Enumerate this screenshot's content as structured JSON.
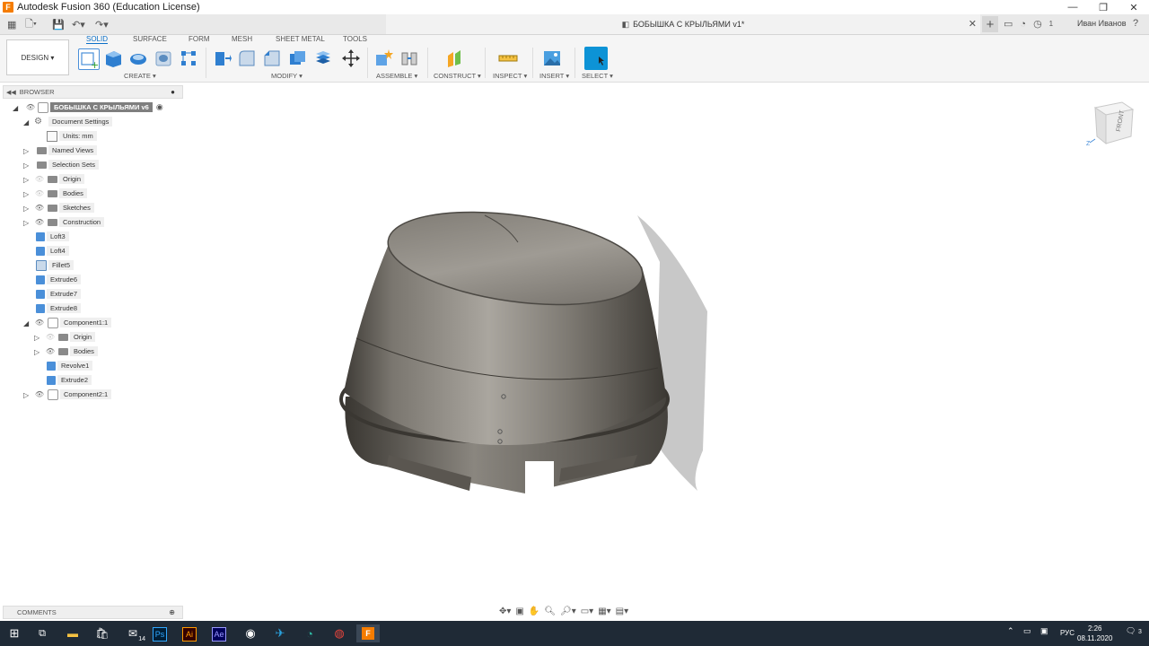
{
  "window": {
    "title": "Autodesk Fusion 360 (Education License)",
    "app_icon": "F"
  },
  "document_tab": {
    "title": "БОБЫШКА С КРЫЛЬЯМИ v1*"
  },
  "user": {
    "name": "Иван Иванов",
    "notifications": "1"
  },
  "ribbon": {
    "workspace": "DESIGN ▾",
    "tabs": [
      "SOLID",
      "SURFACE",
      "FORM",
      "MESH",
      "SHEET METAL",
      "TOOLS"
    ],
    "groups": {
      "create": "CREATE ▾",
      "modify": "MODIFY ▾",
      "assemble": "ASSEMBLE ▾",
      "construct": "CONSTRUCT ▾",
      "inspect": "INSPECT ▾",
      "insert": "INSERT ▾",
      "select": "SELECT ▾"
    }
  },
  "browser": {
    "title": "BROWSER",
    "items": [
      {
        "label": "БОБЫШКА С КРЫЛЬЯМИ v6"
      },
      {
        "label": "Document Settings"
      },
      {
        "label": "Units: mm"
      },
      {
        "label": "Named Views"
      },
      {
        "label": "Selection Sets"
      },
      {
        "label": "Origin"
      },
      {
        "label": "Bodies"
      },
      {
        "label": "Sketches"
      },
      {
        "label": "Construction"
      },
      {
        "label": "Loft3"
      },
      {
        "label": "Loft4"
      },
      {
        "label": "Fillet5"
      },
      {
        "label": "Extrude6"
      },
      {
        "label": "Extrude7"
      },
      {
        "label": "Extrude8"
      },
      {
        "label": "Component1:1"
      },
      {
        "label": "Origin"
      },
      {
        "label": "Bodies"
      },
      {
        "label": "Revolve1"
      },
      {
        "label": "Extrude2"
      },
      {
        "label": "Component2:1"
      }
    ]
  },
  "viewcube": {
    "face": "FRONT",
    "axis": "Z"
  },
  "comments": {
    "title": "COMMENTS"
  },
  "taskbar": {
    "mail_badge": "14",
    "lang": "РУС",
    "time": "2:26",
    "date": "08.11.2020",
    "notif_count": "3",
    "apps": [
      "Ps",
      "Ai",
      "Ae"
    ]
  }
}
